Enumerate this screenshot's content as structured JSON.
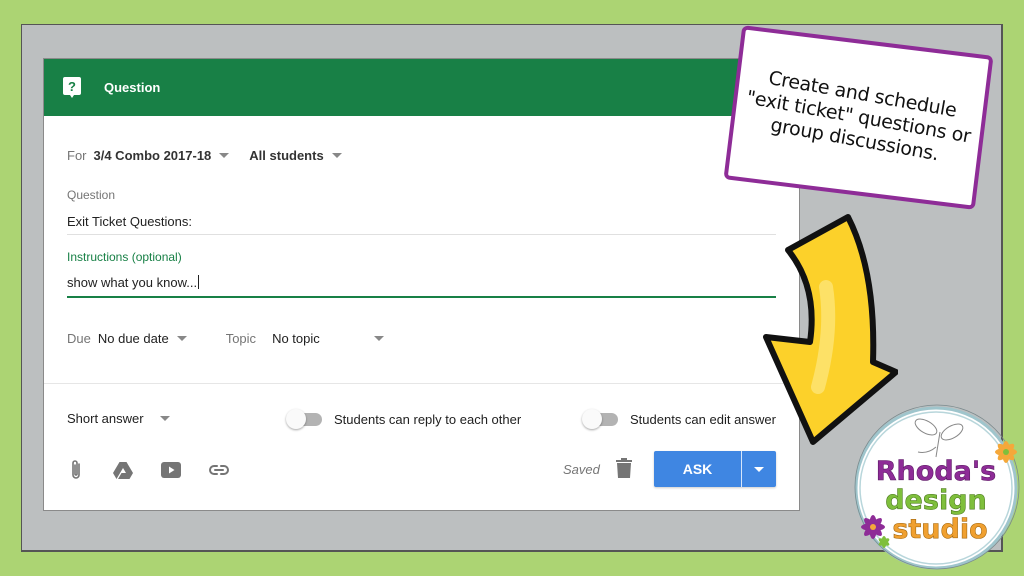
{
  "colors": {
    "background": "#acd473",
    "frame": "#bcbfc0",
    "header": "#188046",
    "accent_blue": "#3f86e2",
    "callout_border": "#8e2c97",
    "arrow_fill": "#fcd12a"
  },
  "card": {
    "header_icon": "question-speech-bubble-icon",
    "title": "Question",
    "for_label": "For",
    "class_value": "3/4 Combo 2017-18",
    "students_value": "All students",
    "question_label": "Question",
    "question_value": "Exit Ticket Questions:",
    "instructions_label": "Instructions (optional)",
    "instructions_value": "show what you know...",
    "due_label": "Due",
    "due_value": "No due date",
    "topic_label": "Topic",
    "topic_value": "No topic",
    "answer_type": "Short answer",
    "toggle_reply_label": "Students can reply to each other",
    "toggle_reply_on": false,
    "toggle_edit_label": "Students can edit answer",
    "toggle_edit_on": false,
    "attach_icons": [
      "paperclip-icon",
      "google-drive-icon",
      "youtube-icon",
      "link-icon"
    ],
    "saved_text": "Saved",
    "ask_label": "ASK"
  },
  "callout": {
    "text": "Create and schedule \"exit ticket\" questions or group discussions."
  },
  "logo": {
    "line1": "Rhoda's",
    "line2": "design",
    "line3": "studio"
  }
}
